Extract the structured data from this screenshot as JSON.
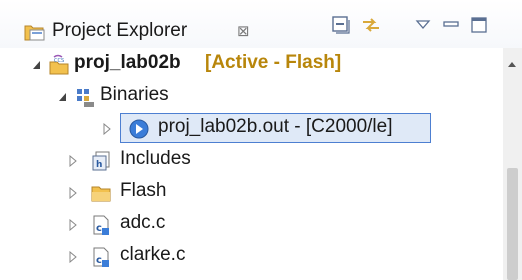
{
  "view": {
    "title": "Project Explorer",
    "close_glyph": "⊠",
    "toolbar": [
      "collapse-all-icon",
      "link-with-editor-icon",
      "view-menu-icon",
      "minimize-icon",
      "maximize-icon"
    ]
  },
  "tree": {
    "project": {
      "name": "proj_lab02b",
      "decoration": "[Active - Flash]",
      "badge": "CCS"
    },
    "binaries": {
      "label": "Binaries"
    },
    "binary_file": {
      "label": "proj_lab02b.out - [C2000/le]"
    },
    "items": [
      {
        "label": "Includes",
        "icon": "includes-icon"
      },
      {
        "label": "Flash",
        "icon": "folder-icon"
      },
      {
        "label": "adc.c",
        "icon": "c-file-icon"
      },
      {
        "label": "clarke.c",
        "icon": "c-file-icon"
      }
    ]
  },
  "colors": {
    "decoration": "#b8860b",
    "selection_fill": "#dfe9f7",
    "selection_border": "#4d7fd1",
    "folder": "#f2c14e"
  }
}
